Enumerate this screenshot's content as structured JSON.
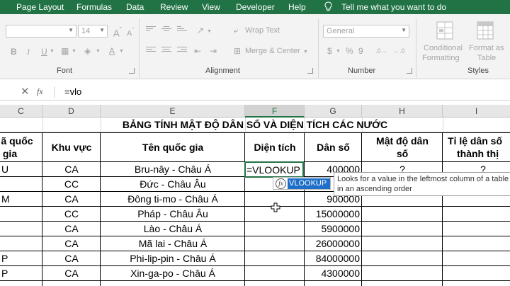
{
  "menu": {
    "tabs": [
      "Page Layout",
      "Formulas",
      "Data",
      "Review",
      "View",
      "Developer",
      "Help"
    ],
    "tell_me": "Tell me what you want to do"
  },
  "ribbon": {
    "font_size": "14",
    "wrap_text": "Wrap Text",
    "merge_center": "Merge & Center",
    "number_format": "General",
    "conditional_formatting": [
      "Conditional",
      "Formatting"
    ],
    "format_as_table": [
      "Format as",
      "Table"
    ],
    "groups": {
      "font": "Font",
      "alignment": "Alignment",
      "number": "Number",
      "styles": "Styles"
    },
    "number_symbols": {
      "percent": "%",
      "comma": "9"
    }
  },
  "formula_bar": {
    "cancel": "✕",
    "enter": "✓",
    "fx": "fx",
    "formula": "=vlo"
  },
  "columns": [
    "C",
    "D",
    "E",
    "F",
    "G",
    "H",
    "I"
  ],
  "sheet": {
    "title": "BẢNG TÍNH MẬT ĐỘ DÂN SỐ VÀ DIỆN TÍCH CÁC NƯỚC",
    "headers": {
      "c": [
        "ã quốc",
        "gia"
      ],
      "d": "Khu vực",
      "e": "Tên quốc gia",
      "f": "Diện tích",
      "g": "Dân số",
      "h": [
        "Mật độ dân",
        "số"
      ],
      "i": [
        "Tỉ lệ dân số",
        "thành thị"
      ]
    },
    "rows": [
      {
        "c": "U",
        "d": "CA",
        "e": "Bru-nây - Châu Á",
        "f": "",
        "g": "400000",
        "h": "?",
        "i": "?"
      },
      {
        "c": "",
        "d": "CC",
        "e": "Đức - Châu Âu",
        "f": "",
        "g": "",
        "h": "",
        "i": ""
      },
      {
        "c": "M",
        "d": "CA",
        "e": "Đông ti-mo - Châu Á",
        "f": "",
        "g": "900000",
        "h": "",
        "i": ""
      },
      {
        "c": "",
        "d": "CC",
        "e": "Pháp - Châu Âu",
        "f": "",
        "g": "15000000",
        "h": "",
        "i": ""
      },
      {
        "c": "",
        "d": "CA",
        "e": "Lào - Châu Á",
        "f": "",
        "g": "5900000",
        "h": "",
        "i": ""
      },
      {
        "c": "",
        "d": "CA",
        "e": "Mã lai - Châu Á",
        "f": "",
        "g": "26000000",
        "h": "",
        "i": ""
      },
      {
        "c": "P",
        "d": "CA",
        "e": "Phi-lip-pin - Châu Á",
        "f": "",
        "g": "84000000",
        "h": "",
        "i": ""
      },
      {
        "c": "P",
        "d": "CA",
        "e": "Xin-ga-po - Châu Á",
        "f": "",
        "g": "4300000",
        "h": "",
        "i": ""
      }
    ],
    "active_cell_value": "=VLOOKUP"
  },
  "autocomplete": {
    "icon": "fx",
    "function_name": "VLOOKUP",
    "tooltip": [
      "Looks for a value in the leftmost column of a table",
      "in an ascending order"
    ]
  },
  "colors": {
    "excel_green": "#217346",
    "highlight_blue": "#1e6fc9"
  }
}
